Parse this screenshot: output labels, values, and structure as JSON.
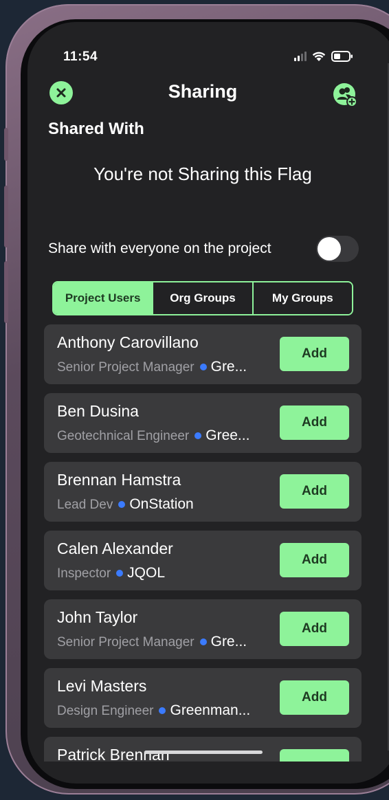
{
  "status_bar": {
    "time": "11:54",
    "icons": [
      "cellular-signal-icon",
      "wifi-icon",
      "battery-icon"
    ]
  },
  "header": {
    "title": "Sharing",
    "close_icon": "close-icon",
    "add_user_icon": "add-user-icon"
  },
  "shared_with": {
    "title": "Shared With",
    "empty_message": "You're not Sharing this Flag"
  },
  "share_everyone": {
    "label": "Share with everyone on the project",
    "enabled": false
  },
  "tabs": [
    {
      "label": "Project Users",
      "active": true
    },
    {
      "label": "Org Groups",
      "active": false
    },
    {
      "label": "My Groups",
      "active": false
    }
  ],
  "users": [
    {
      "name": "Anthony Carovillano",
      "role": "Senior Project Manager",
      "org": "Gre...",
      "action": "Add"
    },
    {
      "name": "Ben Dusina",
      "role": "Geotechnical Engineer",
      "org": "Gree...",
      "action": "Add"
    },
    {
      "name": "Brennan Hamstra",
      "role": "Lead Dev",
      "org": "OnStation",
      "action": "Add"
    },
    {
      "name": "Calen Alexander",
      "role": "Inspector",
      "org": "JQOL",
      "action": "Add"
    },
    {
      "name": "John Taylor",
      "role": "Senior Project Manager",
      "org": "Gre...",
      "action": "Add"
    },
    {
      "name": "Levi Masters",
      "role": "Design Engineer",
      "org": "Greenman...",
      "action": "Add"
    },
    {
      "name": "Patrick Brennan",
      "role": "",
      "org": "",
      "action": ""
    }
  ],
  "colors": {
    "accent_green": "#8ef39a",
    "card_bg": "#3a3a3c",
    "screen_bg": "#222224",
    "dot_blue": "#3b7bff"
  }
}
